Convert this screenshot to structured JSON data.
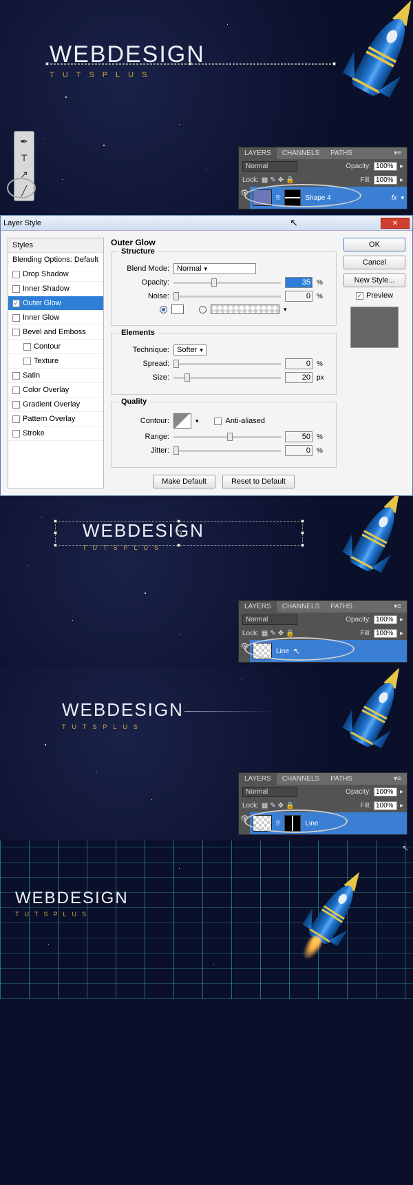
{
  "logo": {
    "title": "WEBDESIGN",
    "subtitle": "TUTSPLUS"
  },
  "layers_panel": {
    "tabs": [
      "LAYERS",
      "CHANNELS",
      "PATHS"
    ],
    "blend_mode": "Normal",
    "opacity_label": "Opacity:",
    "opacity_value": "100%",
    "lock_label": "Lock:",
    "fill_label": "Fill:",
    "fill_value": "100%",
    "layer1_name": "Shape 4",
    "layer1_fx": "fx",
    "layer2_name": "Line",
    "layer3_name": "Line"
  },
  "layer_style": {
    "title": "Layer Style",
    "list_header": "Styles",
    "list_sub": "Blending Options: Default",
    "items": [
      "Drop Shadow",
      "Inner Shadow",
      "Outer Glow",
      "Inner Glow",
      "Bevel and Emboss",
      "Contour",
      "Texture",
      "Satin",
      "Color Overlay",
      "Gradient Overlay",
      "Pattern Overlay",
      "Stroke"
    ],
    "section_title": "Outer Glow",
    "structure": {
      "legend": "Structure",
      "blend_mode_label": "Blend Mode:",
      "blend_mode_value": "Normal",
      "opacity_label": "Opacity:",
      "opacity_value": "35",
      "noise_label": "Noise:",
      "noise_value": "0",
      "pct": "%"
    },
    "elements": {
      "legend": "Elements",
      "technique_label": "Technique:",
      "technique_value": "Softer",
      "spread_label": "Spread:",
      "spread_value": "0",
      "size_label": "Size:",
      "size_value": "20",
      "pct": "%",
      "px": "px"
    },
    "quality": {
      "legend": "Quality",
      "contour_label": "Contour:",
      "anti_aliased": "Anti-aliased",
      "range_label": "Range:",
      "range_value": "50",
      "jitter_label": "Jitter:",
      "jitter_value": "0",
      "pct": "%"
    },
    "buttons": {
      "make_default": "Make Default",
      "reset_default": "Reset to Default",
      "ok": "OK",
      "cancel": "Cancel",
      "new_style": "New Style...",
      "preview": "Preview"
    }
  }
}
